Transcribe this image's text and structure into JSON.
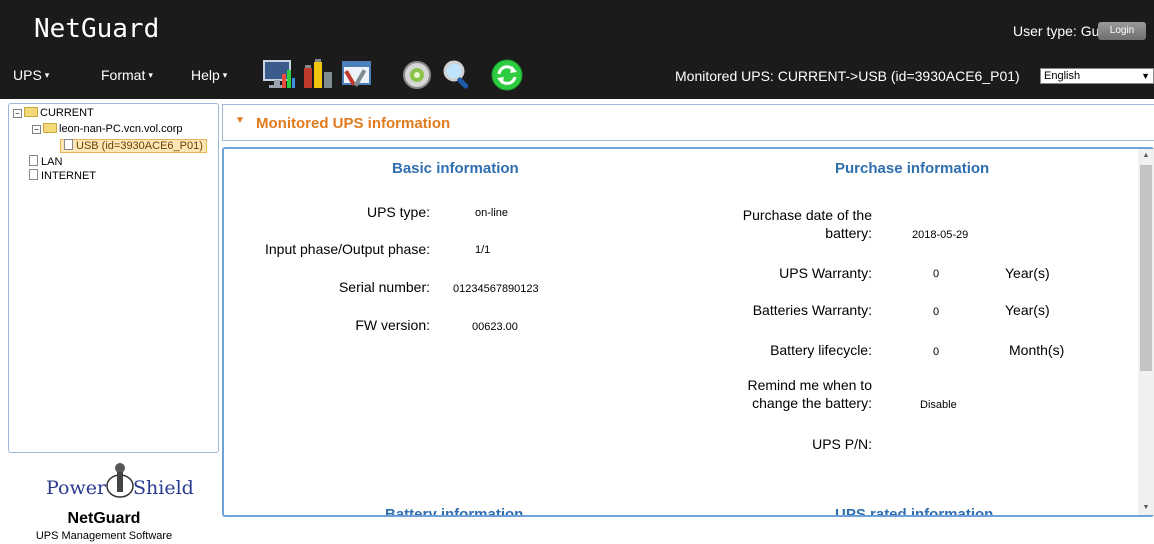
{
  "header": {
    "brand": "NetGuard",
    "user_type": "User type: Guest",
    "login_label": "Login",
    "monitored": "Monitored UPS: CURRENT->USB (id=3930ACE6_P01)",
    "language": "English"
  },
  "menus": [
    {
      "label": "UPS"
    },
    {
      "label": "Format"
    },
    {
      "label": "Help"
    }
  ],
  "toolbar_icons": [
    "monitor-chart-icon",
    "battery-bars-icon",
    "settings-tools-icon",
    "event-log-icon",
    "search-icon",
    "refresh-icon"
  ],
  "tree": {
    "root": "CURRENT",
    "host": "leon-nan-PC.vcn.vol.corp",
    "usb": "USB (id=3930ACE6_P01)",
    "lan": "LAN",
    "internet": "INTERNET"
  },
  "logo": {
    "mark_text": "PowerShield",
    "name": "NetGuard",
    "subtitle": "UPS Management Software"
  },
  "section": {
    "title": "Monitored UPS information"
  },
  "basic": {
    "heading": "Basic information",
    "ups_type_label": "UPS type:",
    "ups_type": "on-line",
    "phase_label": "Input phase/Output phase:",
    "phase": "1/1",
    "serial_label": "Serial number:",
    "serial": "01234567890123",
    "fw_label": "FW version:",
    "fw": "00623.00"
  },
  "purchase": {
    "heading": "Purchase information",
    "date_label_1": "Purchase date of the",
    "date_label_2": "battery:",
    "date": "2018-05-29",
    "ups_warranty_label": "UPS Warranty:",
    "ups_warranty": "0",
    "ups_warranty_unit": "Year(s)",
    "bat_warranty_label": "Batteries Warranty:",
    "bat_warranty": "0",
    "bat_warranty_unit": "Year(s)",
    "lifecycle_label": "Battery lifecycle:",
    "lifecycle": "0",
    "lifecycle_unit": "Month(s)",
    "remind_label_1": "Remind me when to",
    "remind_label_2": "change the battery:",
    "remind": "Disable",
    "pn_label": "UPS P/N:",
    "pn": ""
  },
  "lower": {
    "battery_heading": "Battery information",
    "rated_heading": "UPS rated information"
  },
  "colors": {
    "header_bg": "#1b1b1b",
    "accent_orange": "#e07a1c",
    "heading_blue": "#2f6fb0",
    "panel_border": "#6ea2d8"
  }
}
